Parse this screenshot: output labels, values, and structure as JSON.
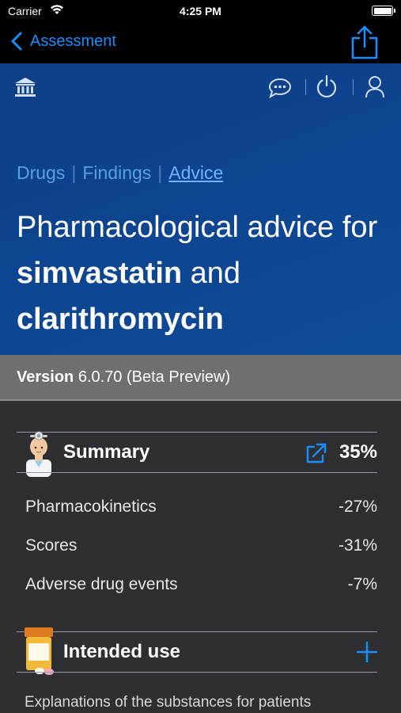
{
  "status_bar": {
    "carrier": "Carrier",
    "time": "4:25 PM"
  },
  "nav": {
    "back_label": "Assessment"
  },
  "header_icons": [
    "bank-icon",
    "chat-icon",
    "power-icon",
    "user-icon"
  ],
  "breadcrumbs": {
    "drugs": "Drugs",
    "findings": "Findings",
    "advice": "Advice"
  },
  "title": {
    "prefix": "Pharmacological advice for",
    "drug1": "simvastatin",
    "connector": "and",
    "drug2": "clarithromycin"
  },
  "version": {
    "label": "Version",
    "value": "6.0.70 (Beta Preview)"
  },
  "summary": {
    "label": "Summary",
    "percent": "35%",
    "metrics": [
      {
        "name": "Pharmacokinetics",
        "value": "-27%"
      },
      {
        "name": "Scores",
        "value": "-31%"
      },
      {
        "name": "Adverse drug events",
        "value": "-7%"
      }
    ]
  },
  "intended_use": {
    "label": "Intended use",
    "explanation": "Explanations of the substances for patients"
  },
  "colors": {
    "accent": "#1a8dff",
    "hero_blue": "#0d4590",
    "background": "#2e2f33"
  }
}
